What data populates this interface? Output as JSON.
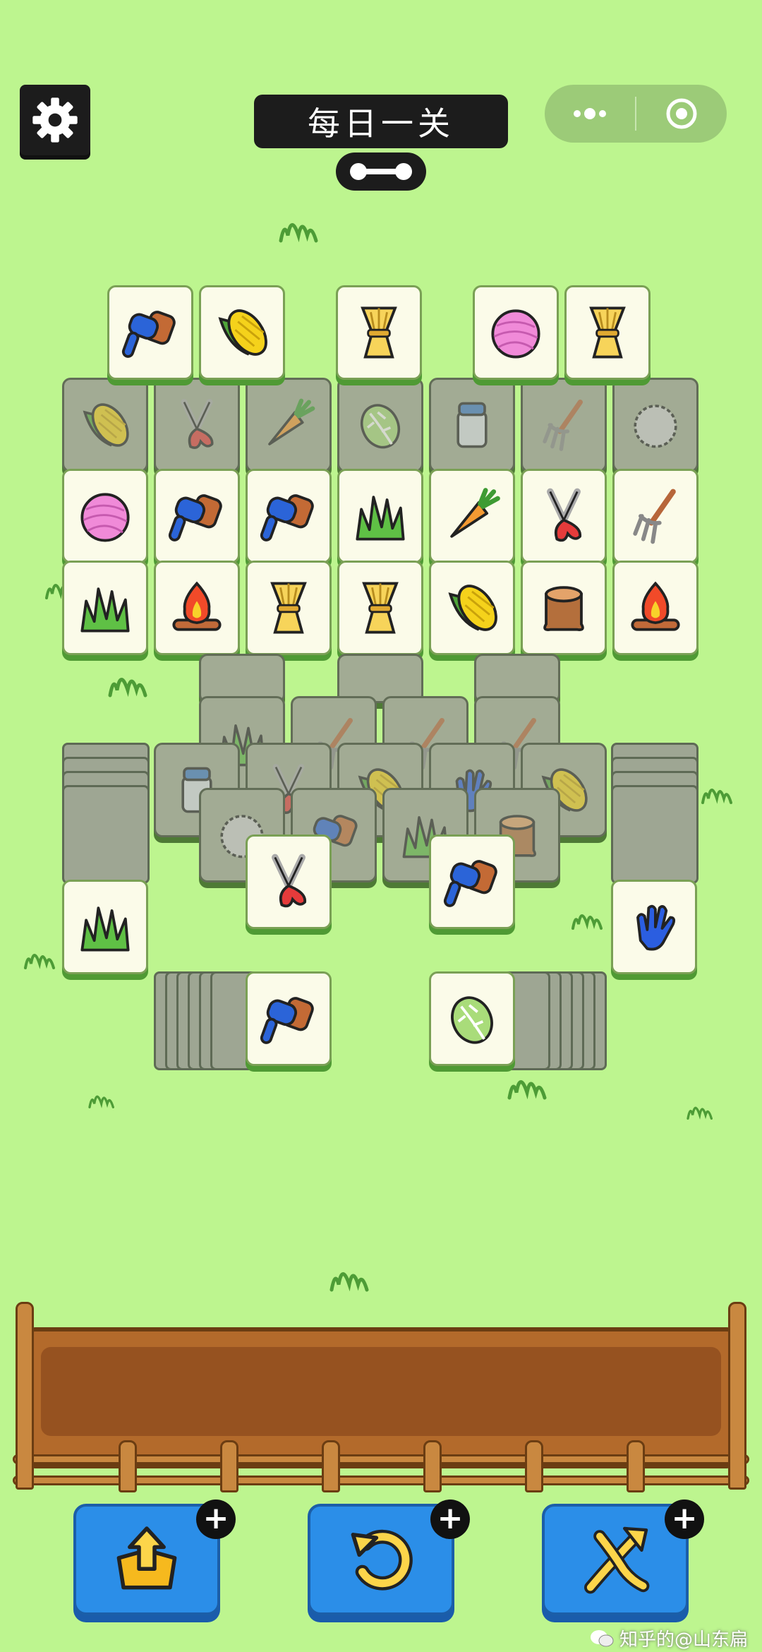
{
  "header": {
    "title": "每日一关",
    "settings_icon": "gear-icon",
    "more_icon": "more-dots-icon",
    "close_icon": "target-circle-icon",
    "toggle_icon": "bone-toggle-icon"
  },
  "board": {
    "top_row": [
      "brush",
      "corn",
      "wheat",
      "yarn",
      "wheat"
    ],
    "row_a": [
      "yarn",
      "brush",
      "brush",
      "grass",
      "carrot",
      "shears",
      "fork"
    ],
    "row_b": [
      "grass",
      "fire",
      "wheat",
      "wheat",
      "corn",
      "stump",
      "fire"
    ],
    "mid_visible": [
      "shears",
      "brush"
    ],
    "left_column_top": "grass",
    "right_column_top": "glove",
    "bottom_left_top": "brush",
    "bottom_right_top": "cabbage"
  },
  "powerups": [
    {
      "name": "undo-out",
      "icon": "box-up-arrow-icon",
      "badge": "+"
    },
    {
      "name": "undo",
      "icon": "undo-arrow-icon",
      "badge": "+"
    },
    {
      "name": "shuffle",
      "icon": "shuffle-arrows-icon",
      "badge": "+"
    }
  ],
  "watermark": "知乎的@山东扁",
  "colors": {
    "background": "#bdf58f",
    "tile": "#fbfbe9",
    "tray": "#b36a2b",
    "button": "#2b8ee8"
  }
}
